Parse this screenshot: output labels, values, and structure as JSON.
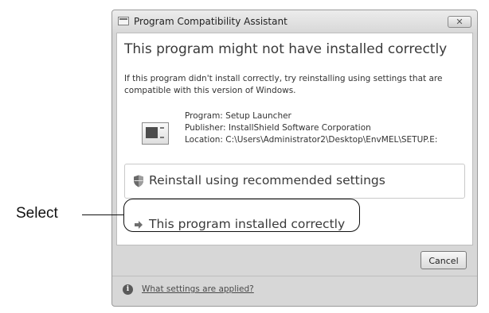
{
  "window": {
    "title": "Program Compatibility Assistant",
    "close_label": "✕"
  },
  "dialog": {
    "heading": "This program might not have installed correctly",
    "description": "If this program didn't install correctly, try reinstalling using settings that are compatible with this version of Windows.",
    "program": "Program: Setup Launcher",
    "publisher": "Publisher: InstallShield Software Corporation",
    "location": "Location: C:\\Users\\Administrator2\\Desktop\\EnvMEL\\SETUP.E:"
  },
  "options": {
    "reinstall_label": "Reinstall using recommended settings",
    "installed_correctly_label": "This program installed correctly"
  },
  "footer": {
    "cancel_label": "Cancel",
    "settings_link": "What settings are applied?"
  },
  "annotation": {
    "label": "Select"
  },
  "icons": {
    "window": "app-icon",
    "program": "program-icon",
    "reinstall": "shield-icon",
    "installed": "arrow-icon",
    "help": "info-icon"
  }
}
